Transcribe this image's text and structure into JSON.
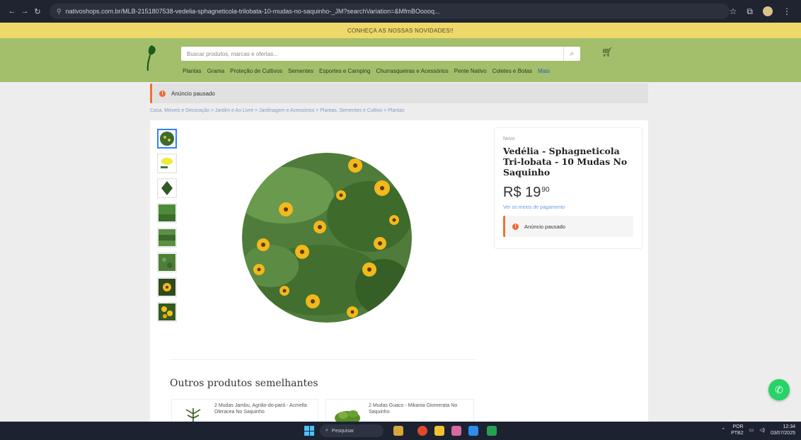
{
  "browser": {
    "url": "nativoshops.com.br/MLB-2151807538-vedelia-sphagneticola-trilobata-10-mudas-no-saquinho-_JM?searchVariation=&MfmBOoooq...",
    "back_icon": "arrow-left-icon",
    "forward_icon": "arrow-right-icon",
    "reload_icon": "reload-icon"
  },
  "promo": {
    "text": "CONHEÇA AS NOSSAS NOVIDADES!!"
  },
  "header": {
    "search_placeholder": "Buscar produtos, marcas e ofertas...",
    "categories": [
      "Plantas",
      "Grama",
      "Proteção de Cultivos",
      "Sementes",
      "Esportes e Camping",
      "Churrasqueiras e Acessórios",
      "Pente Nativo",
      "Coletes e Botas",
      "Mais"
    ]
  },
  "notice": {
    "paused_label": "Anúncio pausado"
  },
  "breadcrumb": "Casa, Móveis e Decoração > Jardim e Ao Livre > Jardinagem e Acessórios > Plantas, Sementes e Cultivo > Plantas",
  "product": {
    "condition": "Novo",
    "title": "Vedélia - Sphagneticola Tri-lobata - 10 Mudas No Saquinho",
    "price_currency": "R$",
    "price_int": "19",
    "price_cents": "90",
    "payment_link": "Ver os meios de pagamento",
    "paused_label": "Anúncio pausado"
  },
  "similar": {
    "title": "Outros produtos semelhantes",
    "items": [
      {
        "name": "2 Mudas Jambu, Agrião-do-pará - Acmella Oleracea No Saquinho"
      },
      {
        "name": "2 Mudas Guaco - Mikania Glomerata No Saquinho"
      }
    ]
  },
  "taskbar": {
    "search_label": "Pesquisar",
    "lang": "POR",
    "lang_sub": "PTB2",
    "time": "12:34",
    "date": "03/07/2025"
  }
}
